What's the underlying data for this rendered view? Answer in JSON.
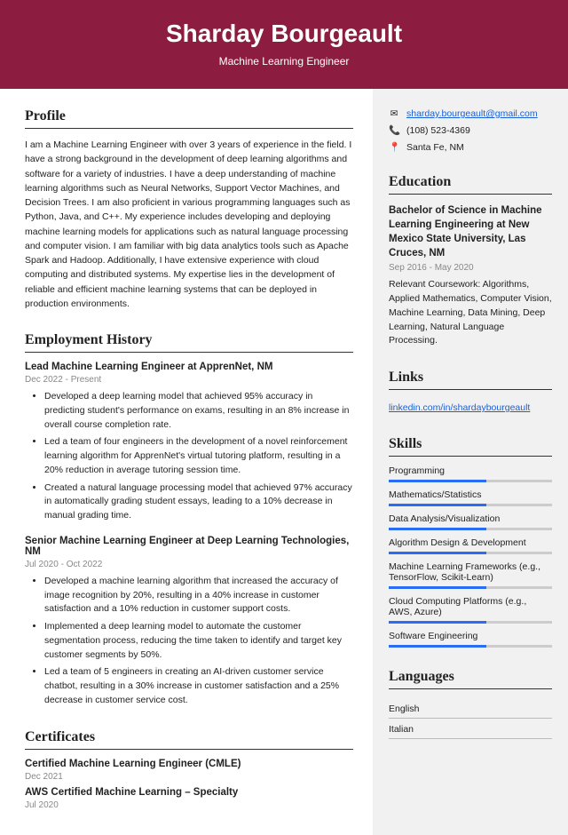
{
  "header": {
    "name": "Sharday Bourgeault",
    "title": "Machine Learning Engineer"
  },
  "profile": {
    "heading": "Profile",
    "text": "I am a Machine Learning Engineer with over 3 years of experience in the field. I have a strong background in the development of deep learning algorithms and software for a variety of industries. I have a deep understanding of machine learning algorithms such as Neural Networks, Support Vector Machines, and Decision Trees. I am also proficient in various programming languages such as Python, Java, and C++. My experience includes developing and deploying machine learning models for applications such as natural language processing and computer vision. I am familiar with big data analytics tools such as Apache Spark and Hadoop. Additionally, I have extensive experience with cloud computing and distributed systems. My expertise lies in the development of reliable and efficient machine learning systems that can be deployed in production environments."
  },
  "employment": {
    "heading": "Employment History",
    "jobs": [
      {
        "title": "Lead Machine Learning Engineer at ApprenNet, NM",
        "date": "Dec 2022 - Present",
        "bullets": [
          "Developed a deep learning model that achieved 95% accuracy in predicting student's performance on exams, resulting in an 8% increase in overall course completion rate.",
          "Led a team of four engineers in the development of a novel reinforcement learning algorithm for ApprenNet's virtual tutoring platform, resulting in a 20% reduction in average tutoring session time.",
          "Created a natural language processing model that achieved 97% accuracy in automatically grading student essays, leading to a 10% decrease in manual grading time."
        ]
      },
      {
        "title": "Senior Machine Learning Engineer at Deep Learning Technologies, NM",
        "date": "Jul 2020 - Oct 2022",
        "bullets": [
          "Developed a machine learning algorithm that increased the accuracy of image recognition by 20%, resulting in a 40% increase in customer satisfaction and a 10% reduction in customer support costs.",
          "Implemented a deep learning model to automate the customer segmentation process, reducing the time taken to identify and target key customer segments by 50%.",
          "Led a team of 5 engineers in creating an AI-driven customer service chatbot, resulting in a 30% increase in customer satisfaction and a 25% decrease in customer service cost."
        ]
      }
    ]
  },
  "certificates": {
    "heading": "Certificates",
    "items": [
      {
        "title": "Certified Machine Learning Engineer (CMLE)",
        "date": "Dec 2021"
      },
      {
        "title": "AWS Certified Machine Learning – Specialty",
        "date": "Jul 2020"
      }
    ]
  },
  "contact": {
    "email": "sharday.bourgeault@gmail.com",
    "phone": "(108) 523-4369",
    "location": "Santa Fe, NM"
  },
  "education": {
    "heading": "Education",
    "title": "Bachelor of Science in Machine Learning Engineering at New Mexico State University, Las Cruces, NM",
    "date": "Sep 2016 - May 2020",
    "desc": "Relevant Coursework: Algorithms, Applied Mathematics, Computer Vision, Machine Learning, Data Mining, Deep Learning, Natural Language Processing."
  },
  "links": {
    "heading": "Links",
    "url": "linkedin.com/in/shardaybourgeault"
  },
  "skills": {
    "heading": "Skills",
    "items": [
      "Programming",
      "Mathematics/Statistics",
      "Data Analysis/Visualization",
      "Algorithm Design & Development",
      "Machine Learning Frameworks (e.g., TensorFlow, Scikit-Learn)",
      "Cloud Computing Platforms (e.g., AWS, Azure)",
      "Software Engineering"
    ]
  },
  "languages": {
    "heading": "Languages",
    "items": [
      "English",
      "Italian"
    ]
  }
}
